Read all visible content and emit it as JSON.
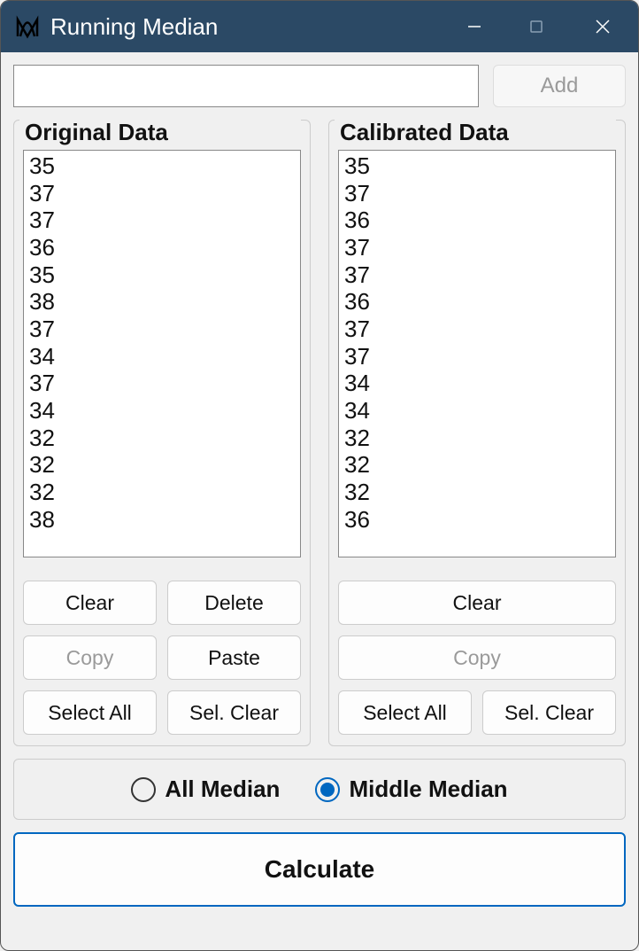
{
  "window": {
    "title": "Running Median"
  },
  "add": {
    "input_value": "",
    "button_label": "Add"
  },
  "original": {
    "title": "Original Data",
    "items": [
      "35",
      "37",
      "37",
      "36",
      "35",
      "38",
      "37",
      "34",
      "37",
      "34",
      "32",
      "32",
      "32",
      "38"
    ],
    "buttons": {
      "clear": "Clear",
      "delete": "Delete",
      "copy": "Copy",
      "paste": "Paste",
      "select_all": "Select All",
      "sel_clear": "Sel. Clear"
    }
  },
  "calibrated": {
    "title": "Calibrated Data",
    "items": [
      "35",
      "37",
      "36",
      "37",
      "37",
      "36",
      "37",
      "37",
      "34",
      "34",
      "32",
      "32",
      "32",
      "36"
    ],
    "buttons": {
      "clear": "Clear",
      "copy": "Copy",
      "select_all": "Select All",
      "sel_clear": "Sel. Clear"
    }
  },
  "radio": {
    "all_median": "All Median",
    "middle_median": "Middle Median",
    "selected": "middle_median"
  },
  "calculate_label": "Calculate"
}
